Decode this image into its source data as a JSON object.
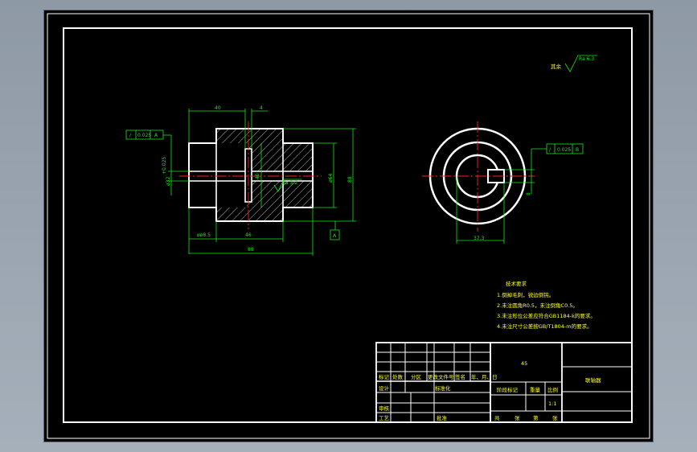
{
  "dims": {
    "d40": "40",
    "d4": "4",
    "d40v": "40",
    "d46": "46",
    "d8_5": "øø8.5",
    "d88": "88",
    "d64": "ø64",
    "d88v": "88",
    "ra": "Ra 3.2",
    "bore": "ø32",
    "bore_tol": "+0.025",
    "d37": "37.3",
    "d8": "8"
  },
  "tolerance": {
    "left_sym": "/",
    "left_val": "0.025",
    "left_ref": "A",
    "right_sym": "/",
    "right_val": "0.025",
    "right_ref": "B",
    "datum": "A"
  },
  "roughness": {
    "label": "其余",
    "value": "Ra 6.3"
  },
  "tech": {
    "title": "技术要求",
    "items": [
      "1.倒掉毛刺，锐边倒钝。",
      "2.未注圆角R0.5，未注倒角C0.5。",
      "3.未注形位公差应符合GB1184-k的要求。",
      "4.未注尺寸公差按GB/T1804-m的要求。"
    ]
  },
  "titleblock": {
    "h_mark": "标记",
    "h_count": "处数",
    "h_zone": "分区",
    "h_doc": "更改文件号",
    "h_sign": "签名",
    "h_date": "年、月、日",
    "design": "设计",
    "standard": "标准化",
    "review": "审核",
    "process": "工艺",
    "approve": "批准",
    "material": "45",
    "stage": "阶段标记",
    "weight": "重量",
    "scale": "比例",
    "scale_val": "1:1",
    "sheets": "共",
    "sheet_unit": "张",
    "sheet_no": "第",
    "sheet_unit2": "张",
    "part_name": "联轴器"
  }
}
